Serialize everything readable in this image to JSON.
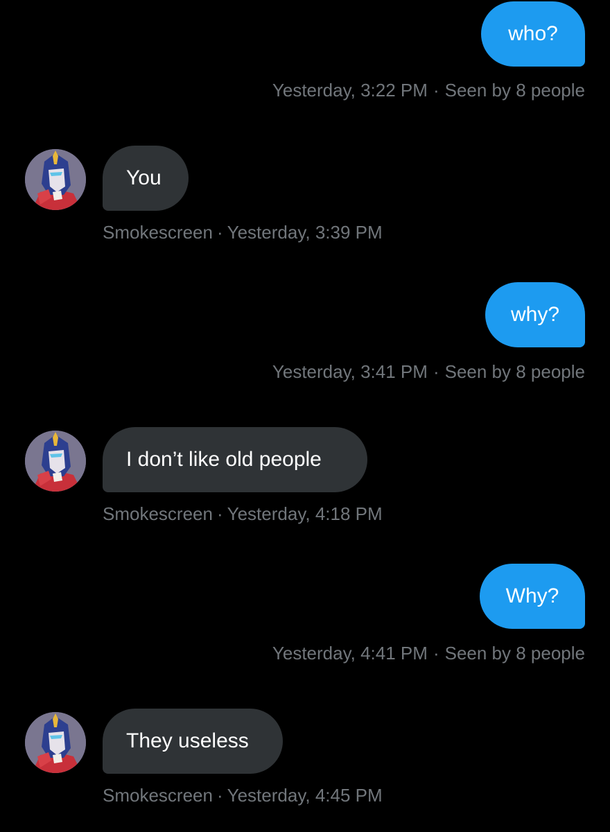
{
  "conversation": {
    "messages": [
      {
        "direction": "out",
        "text": "who?",
        "time": "Yesterday, 3:22 PM",
        "seen": "Seen by 8 people"
      },
      {
        "direction": "in",
        "text": "You",
        "sender": "Smokescreen",
        "time": "Yesterday, 3:39 PM"
      },
      {
        "direction": "out",
        "text": "why?",
        "time": "Yesterday, 3:41 PM",
        "seen": "Seen by 8 people"
      },
      {
        "direction": "in",
        "text": "I don’t like old people",
        "sender": "Smokescreen",
        "time": "Yesterday, 4:18 PM"
      },
      {
        "direction": "out",
        "text": "Why?",
        "time": "Yesterday, 4:41 PM",
        "seen": "Seen by 8 people"
      },
      {
        "direction": "in",
        "text": "They useless",
        "sender": "Smokescreen",
        "time": "Yesterday, 4:45 PM"
      }
    ],
    "separator": "·"
  },
  "colors": {
    "background": "#000000",
    "outgoing_bubble": "#1d9bf0",
    "incoming_bubble": "#2f3336",
    "meta_text": "#71767b"
  },
  "icons": {
    "sender_avatar": "robot-character-avatar"
  }
}
